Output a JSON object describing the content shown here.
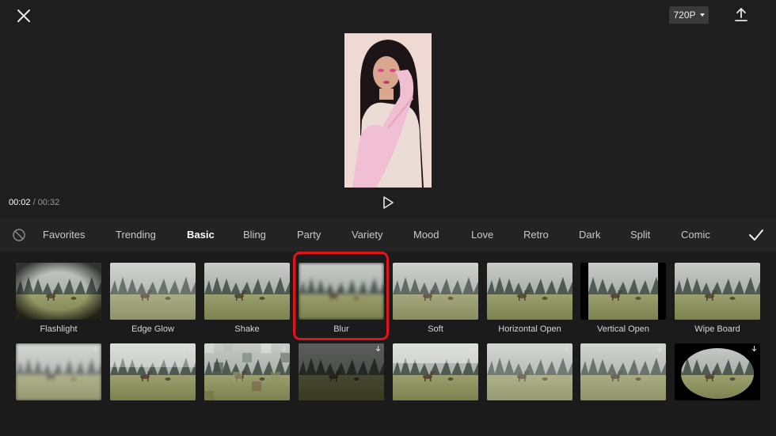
{
  "header": {
    "resolution_label": "720P"
  },
  "player": {
    "current_time": "00:02",
    "separator": " / ",
    "total_time": "00:32"
  },
  "tabs": [
    "Favorites",
    "Trending",
    "Basic",
    "Bling",
    "Party",
    "Variety",
    "Mood",
    "Love",
    "Retro",
    "Dark",
    "Split",
    "Comic"
  ],
  "active_tab": "Basic",
  "effects_row1": [
    "Flashlight",
    "Edge Glow",
    "Shake",
    "Blur",
    "Soft",
    "Horizontal Open",
    "Vertical Open",
    "Wipe Board"
  ],
  "selected_effect": "Blur",
  "colors": {
    "highlight": "#e0141c",
    "background": "#1d1d1d"
  }
}
